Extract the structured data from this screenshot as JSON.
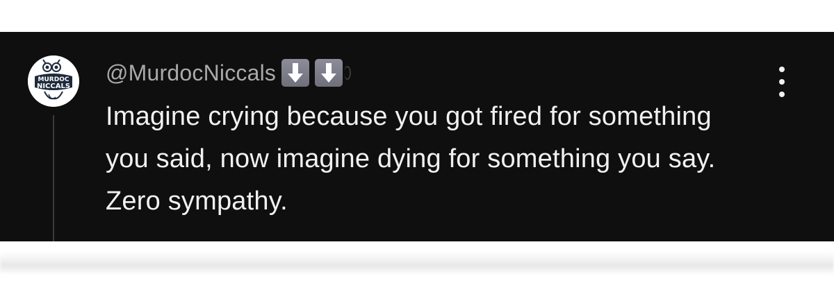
{
  "comment": {
    "author": "@MurdocNiccals",
    "badges": [
      "down-arrow-emoji",
      "down-arrow-emoji"
    ],
    "text": "Imagine crying because you got fired for something you said, now imagine dying for something you say. Zero sympathy.",
    "avatar": {
      "icon": "murdoc-niccals-logo",
      "line1": "MURDOC",
      "line2": "NICCALS"
    },
    "menu_icon": "vertical-ellipsis-icon"
  },
  "colors": {
    "card_bg": "#0f0f0f",
    "author": "#aaaaaa",
    "text": "#f1f1f1",
    "badge": "#7d7d8a"
  }
}
